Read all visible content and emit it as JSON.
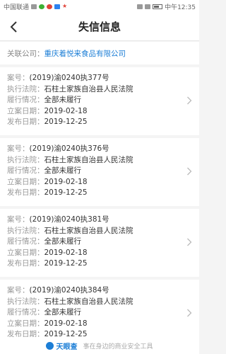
{
  "status_bar": {
    "carrier": "中国联通",
    "time": "中午12:35"
  },
  "header": {
    "title": "失信信息"
  },
  "company": {
    "label": "关联公司：",
    "name": "重庆着悦来食品有限公司"
  },
  "labels": {
    "case_no": "案号：",
    "court": "执行法院：",
    "performance": "履行情况：",
    "filed": "立案日期：",
    "published": "发布日期："
  },
  "records": [
    {
      "case_no": "(2019)渝0240执377号",
      "court": "石柱土家族自治县人民法院",
      "performance": "全部未履行",
      "filed": "2019-02-18",
      "published": "2019-12-25"
    },
    {
      "case_no": "(2019)渝0240执376号",
      "court": "石柱土家族自治县人民法院",
      "performance": "全部未履行",
      "filed": "2019-02-18",
      "published": "2019-12-25"
    },
    {
      "case_no": "(2019)渝0240执381号",
      "court": "石柱土家族自治县人民法院",
      "performance": "全部未履行",
      "filed": "2019-02-18",
      "published": "2019-12-25"
    },
    {
      "case_no": "(2019)渝0240执384号",
      "court": "石柱土家族自治县人民法院",
      "performance": "全部未履行",
      "filed": "2019-02-18",
      "published": "2019-12-25"
    }
  ],
  "footer": {
    "brand": "天眼查",
    "slogan": "事在身边的商业安全工具"
  },
  "colors": {
    "link": "#1c7ed6",
    "background": "#f4f4f4"
  }
}
